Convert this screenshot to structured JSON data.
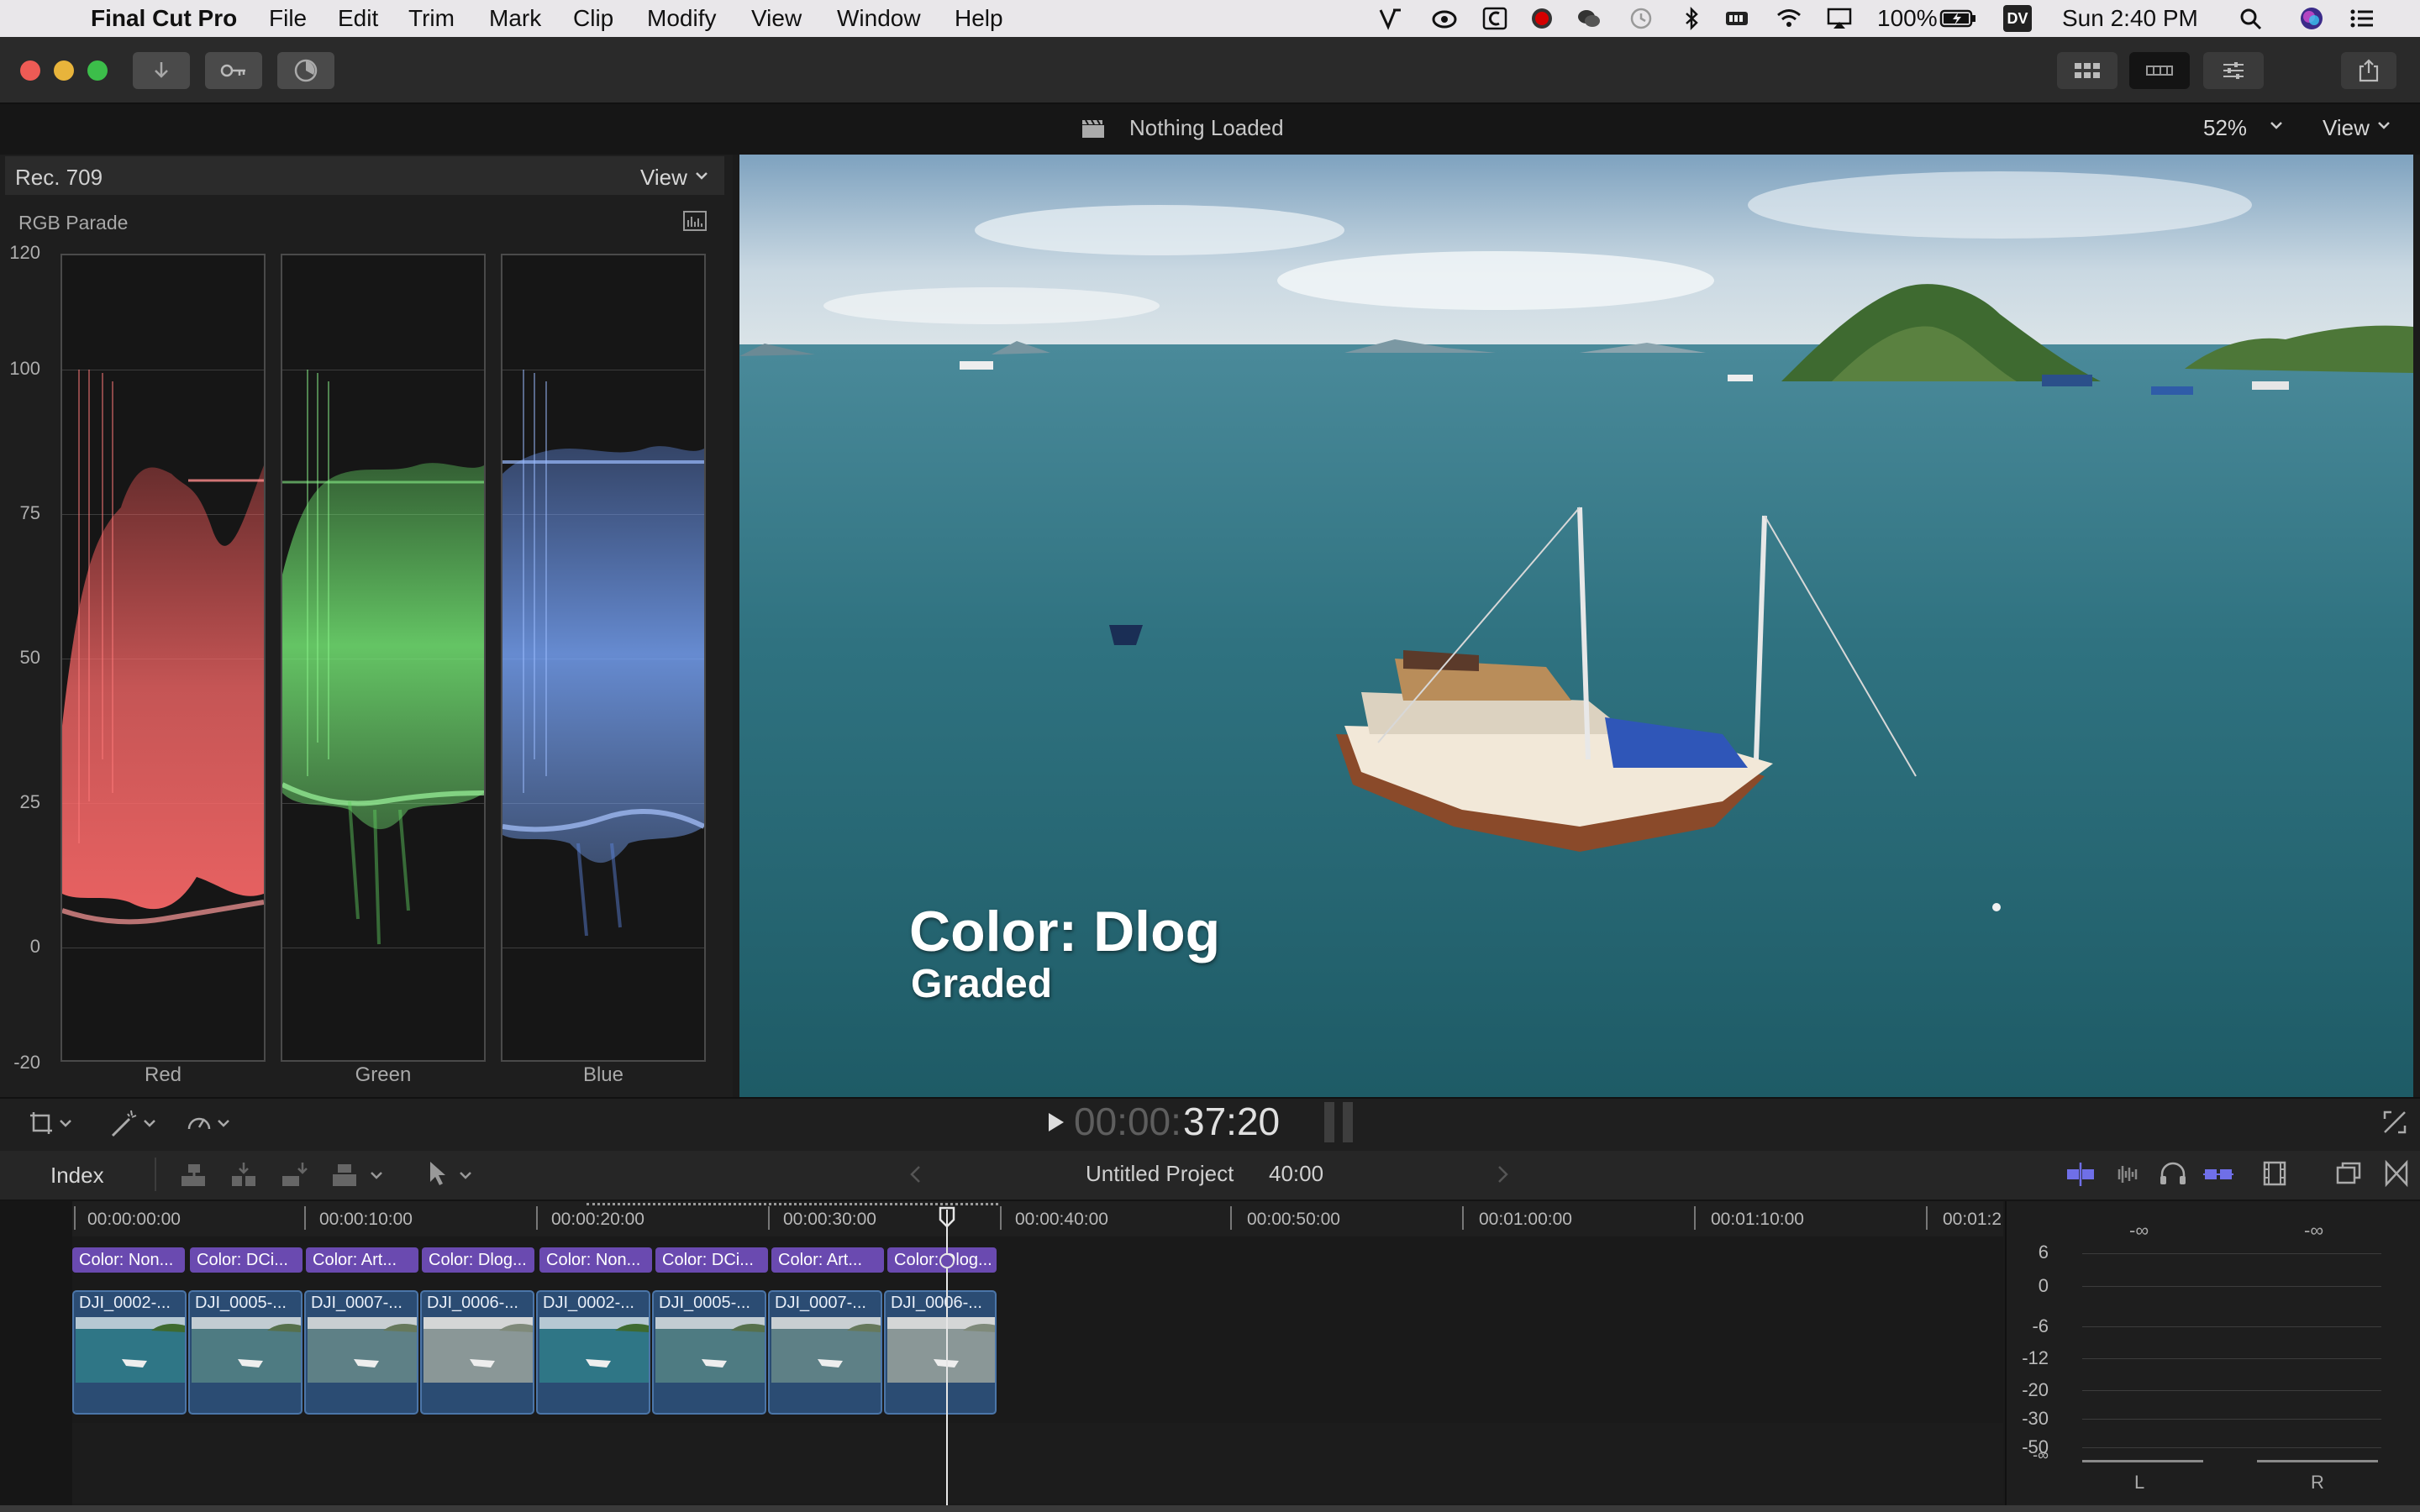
{
  "menubar": {
    "app_name": "Final Cut Pro",
    "items": [
      "File",
      "Edit",
      "Trim",
      "Mark",
      "Clip",
      "Modify",
      "View",
      "Window",
      "Help"
    ],
    "battery": "100%",
    "dv_badge": "DV",
    "clock": "Sun 2:40 PM",
    "tray_icons": [
      "vectorworks-icon",
      "creative-cloud-icon",
      "c-app-icon",
      "record-icon",
      "wechat-icon",
      "time-machine-icon",
      "bluetooth-icon",
      "battery-status-icon",
      "wifi-icon",
      "airplay-icon",
      "battery-icon"
    ]
  },
  "viewer_header": {
    "status": "Nothing Loaded",
    "zoom": "52%",
    "view_label": "View"
  },
  "scopes": {
    "color_space": "Rec. 709",
    "view_label": "View",
    "scope_type": "RGB Parade",
    "y_ticks": [
      "120",
      "100",
      "75",
      "50",
      "25",
      "0",
      "-20"
    ],
    "channels": [
      "Red",
      "Green",
      "Blue"
    ]
  },
  "viewer": {
    "overlay_title": "Color: Dlog",
    "overlay_subtitle": "Graded"
  },
  "transport": {
    "timecode_dim": "00:00:",
    "timecode": "37:20"
  },
  "timeline_toolbar": {
    "index_label": "Index",
    "project_name": "Untitled Project",
    "project_duration": "40:00"
  },
  "timeline": {
    "ruler": [
      "00:00:00:00",
      "00:00:10:00",
      "00:00:20:00",
      "00:00:30:00",
      "00:00:40:00",
      "00:00:50:00",
      "00:01:00:00",
      "00:01:10:00",
      "00:01:2"
    ],
    "title_clips": [
      "Color: Non...",
      "Color: DCi...",
      "Color: Art...",
      "Color: Dlog...",
      "Color: Non...",
      "Color: DCi...",
      "Color: Art...",
      "Color: Dlog..."
    ],
    "video_clips": [
      "DJI_0002-...",
      "DJI_0005-...",
      "DJI_0007-...",
      "DJI_0006-...",
      "DJI_0002-...",
      "DJI_0005-...",
      "DJI_0007-...",
      "DJI_0006-..."
    ]
  },
  "audio_meters": {
    "peak_left": "-∞",
    "peak_right": "-∞",
    "scale": [
      "6",
      "0",
      "-6",
      "-12",
      "-20",
      "-30",
      "-50",
      "-∞"
    ],
    "channel_left": "L",
    "channel_right": "R"
  },
  "colors": {
    "accent_purple": "#6a4ab0",
    "clip_blue": "#2b4c73",
    "red_channel": "#ff6a6a",
    "green_channel": "#78f078",
    "blue_channel": "#7aa8ff"
  }
}
